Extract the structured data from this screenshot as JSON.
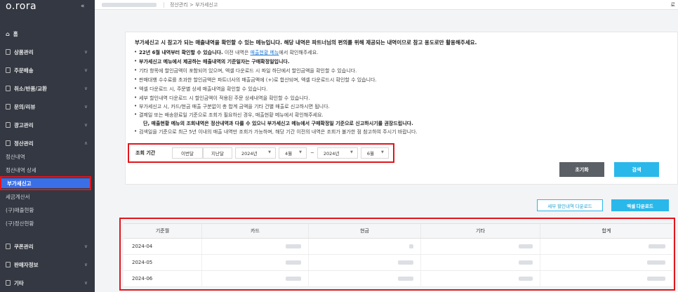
{
  "app": {
    "logo": "o.rora",
    "collapse_icon": "«"
  },
  "topbar": {
    "breadcrumb": "정산관리 > 부가세신고",
    "right_text": "로"
  },
  "sidebar": {
    "home": "홈",
    "menus": [
      {
        "label": "상품관리"
      },
      {
        "label": "주문배송"
      },
      {
        "label": "취소/반품/교환"
      },
      {
        "label": "문의/리뷰"
      },
      {
        "label": "광고관리"
      },
      {
        "label": "정산관리"
      }
    ],
    "settlement_sub": [
      "정산내역",
      "정산내역 상세",
      "부가세신고",
      "세금계산서",
      "(구)매출현황",
      "(구)정산현황"
    ],
    "bottom_menus": [
      {
        "label": "쿠폰관리"
      },
      {
        "label": "판매자정보"
      },
      {
        "label": "기타"
      }
    ]
  },
  "info": {
    "title": "부가세신고 시 참고가 되는 매출내역을 확인할 수 있는 메뉴입니다. 해당 내역은 파트너님의 편의를 위해 제공되는 내역이므로 참고 용도로만 활용해주세요.",
    "b1_bold": "22년 6월 내역부터 확인할 수 있습니다.",
    "b1_pre": " 이전 내역은 ",
    "b1_link": "매출현황 메뉴",
    "b1_post": "에서 확인해주세요.",
    "b2": "부가세신고 메뉴에서 제공하는 매출내역의 기준일자는 구매확정일입니다.",
    "b3": "기타 항목에 할인금액이 포함되어 있으며, 엑셀 다운로드 시 파일 하단에서 할인금액을 확인할 수 있습니다.",
    "b4": "판매대행 수수료를 초과한 할인금액은 파트너사의 매출금액에 (+)로 합산되며, 엑셀 다운로드시 확인할 수 있습니다.",
    "b5": "엑셀 다운로드 시, 주문별 상세 매출내역을 확인할 수 있습니다.",
    "b6": "세부 할인내역 다운로드 시 할인금액이 적용된 주문 상세내역을 확인할 수 있습니다.",
    "b7": "부가세신고 시, 카드/현금 매출 구분없이 총 합계 금액을 기타 건별 매출로 신고하시면 됩니다.",
    "b8": "결제일 또는 배송완료일 기준으로 조회가 필요하신 경우, 매출현황 메뉴에서 확인해주세요.",
    "b9": "단, 매출현황 메뉴의 조회내역은 정산내역과 다를 수 있으니 부가세신고 메뉴에서 구매확정일 기준으로 신고하시기를 권장드립니다.",
    "b10": "검색일을 기준으로 최근 5년 이내의 매출 내역만 조회가 가능하며, 해당 기간 이전의 내역은 조회가 불가한 점 참고하여 주시기 바랍니다."
  },
  "search": {
    "label": "조회 기간",
    "btn_this_month": "이번달",
    "btn_last_month": "지난달",
    "from_year": "2024년",
    "from_month": "4월",
    "tilde": "~",
    "to_year": "2024년",
    "to_month": "6월",
    "reset": "초기화",
    "submit": "검색"
  },
  "downloads": {
    "detail": "세부 할인내역 다운로드",
    "excel": "엑셀 다운로드"
  },
  "table": {
    "headers": [
      "기준월",
      "카드",
      "현금",
      "기타",
      "합계"
    ],
    "rows": [
      {
        "month": "2024-04"
      },
      {
        "month": "2024-05"
      },
      {
        "month": "2024-06"
      }
    ]
  },
  "colors": {
    "accent": "#2ab8ea",
    "highlight": "#e0161c",
    "sidebar_bg": "#333842",
    "active_nav": "#3b6fe8"
  }
}
